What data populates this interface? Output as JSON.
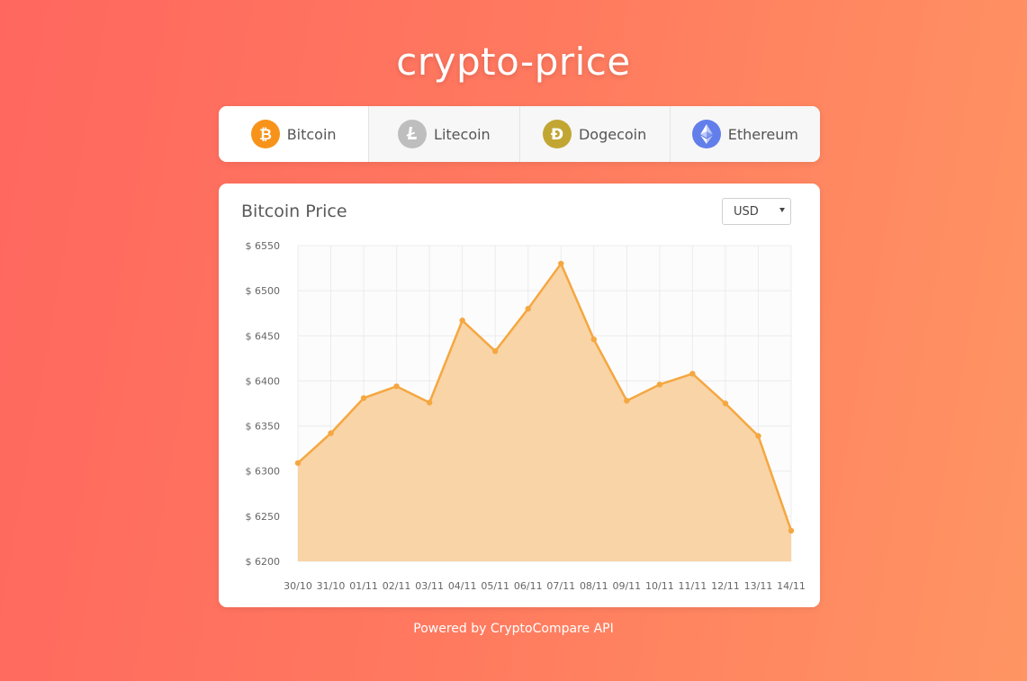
{
  "app": {
    "title": "crypto-price"
  },
  "tabs": [
    {
      "label": "Bitcoin",
      "icon": "bitcoin-icon",
      "color": "#f7931a",
      "active": true
    },
    {
      "label": "Litecoin",
      "icon": "litecoin-icon",
      "color": "#bebebe",
      "active": false
    },
    {
      "label": "Dogecoin",
      "icon": "dogecoin-icon",
      "color": "#c2a633",
      "active": false
    },
    {
      "label": "Ethereum",
      "icon": "ethereum-icon",
      "color": "#627eea",
      "active": false
    }
  ],
  "card": {
    "title": "Bitcoin Price",
    "currency": {
      "selected": "USD"
    }
  },
  "chart_data": {
    "type": "area",
    "categories": [
      "30/10",
      "31/10",
      "01/11",
      "02/11",
      "03/11",
      "04/11",
      "05/11",
      "06/11",
      "07/11",
      "08/11",
      "09/11",
      "10/11",
      "11/11",
      "12/11",
      "13/11",
      "14/11"
    ],
    "series": [
      {
        "values": [
          6309,
          6342,
          6381,
          6394,
          6376,
          6467,
          6433,
          6480,
          6530,
          6446,
          6378,
          6396,
          6408,
          6375,
          6339,
          6234
        ]
      }
    ],
    "ylim": [
      6200,
      6550
    ],
    "yticks": [
      6200,
      6250,
      6300,
      6350,
      6400,
      6450,
      6500,
      6550
    ],
    "ytick_prefix": "$ ",
    "grid": true,
    "line_color": "#f5a740",
    "fill_color": "#f8d2a2"
  },
  "footer": {
    "text": "Powered by CryptoCompare API"
  }
}
